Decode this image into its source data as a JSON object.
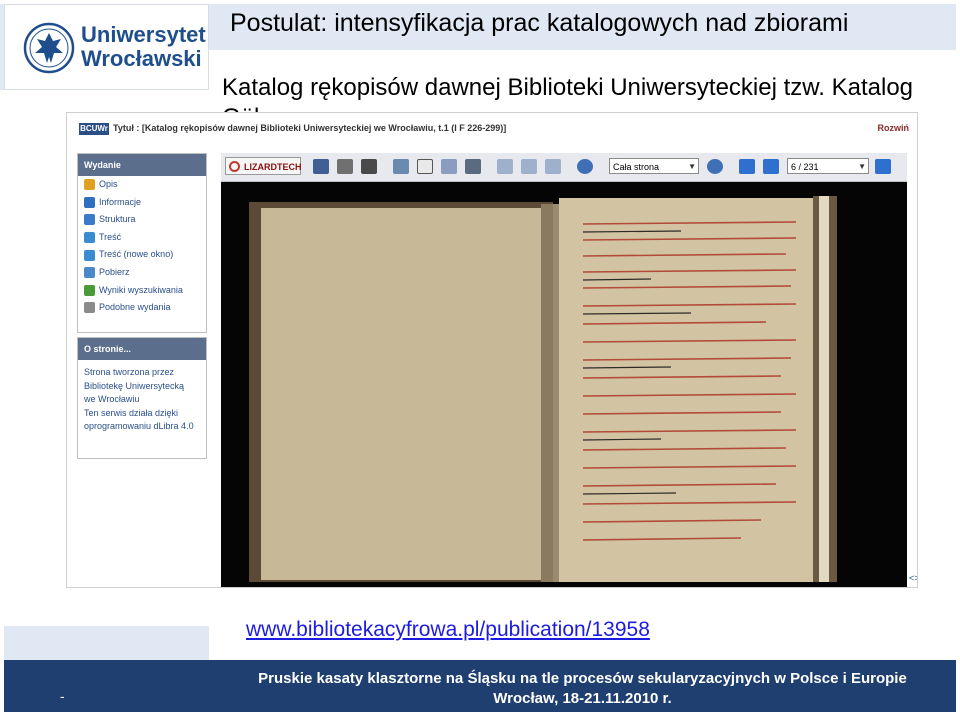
{
  "slide": {
    "logo_line1": "Uniwersytet",
    "logo_line2": "Wrocławski",
    "title": "Postulat: intensyfikacja prac katalogowych nad zbiorami",
    "subtitle": "Katalog rękopisów dawnej Biblioteki Uniwersyteckiej tzw. Katalog Göbera",
    "url": "www.bibliotekacyfrowa.pl/publication/13958",
    "footer_line1": "Pruskie kasaty klasztorne na Śląsku na tle procesów sekularyzacyjnych w Polsce i Europie",
    "footer_line2": "Wrocław, 18-21.11.2010 r.",
    "footer_dash": "-"
  },
  "screenshot": {
    "badge": "BCUWr",
    "title": "Tytuł : [Katalog rękopisów dawnej Biblioteki Uniwersyteckiej we Wrocławiu, t.1 (I F 226-299)]",
    "expand_link": "Rozwiń",
    "sidebar_edition": {
      "heading": "Wydanie",
      "items": [
        {
          "label": "Opis",
          "color": "#e0a020"
        },
        {
          "label": "Informacje",
          "color": "#2f6fc0"
        },
        {
          "label": "Struktura",
          "color": "#3a7ac8"
        },
        {
          "label": "Treść",
          "color": "#3b8bd0"
        },
        {
          "label": "Treść (nowe okno)",
          "color": "#3b8bd0"
        },
        {
          "label": "Pobierz",
          "color": "#4a88c8"
        },
        {
          "label": "Wyniki wyszukiwania",
          "color": "#4a9a3a"
        },
        {
          "label": "Podobne wydania",
          "color": "#8a8a8a"
        }
      ]
    },
    "sidebar_about": {
      "heading": "O stronie...",
      "lines": [
        "Strona tworzona przez",
        "Bibliotekę Uniwersytecką",
        "we Wrocławiu",
        "Ten serwis działa dzięki",
        "oprogramowaniu dLibra 4.0"
      ]
    },
    "viewer": {
      "brand": "LIZARDTECH",
      "zoom_value": "Cała strona",
      "page_value": "6 / 231",
      "expand_icon": "<>"
    }
  }
}
